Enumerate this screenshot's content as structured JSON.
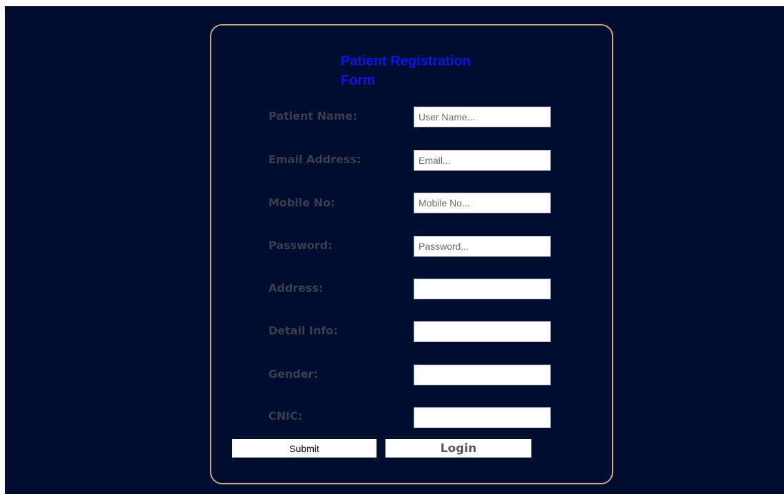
{
  "form": {
    "title": "Patient Registration Form",
    "fields": [
      {
        "label": "Patient Name:",
        "placeholder": "User Name...",
        "value": ""
      },
      {
        "label": "Email Address:",
        "placeholder": "Email...",
        "value": ""
      },
      {
        "label": "Mobile No:",
        "placeholder": "Mobile No...",
        "value": ""
      },
      {
        "label": "Password:",
        "placeholder": "Password...",
        "value": ""
      },
      {
        "label": "Address:",
        "placeholder": "",
        "value": ""
      },
      {
        "label": "Detail Info:",
        "placeholder": "",
        "value": ""
      },
      {
        "label": "Gender:",
        "placeholder": "",
        "value": ""
      },
      {
        "label": "CNIC:",
        "placeholder": "",
        "value": ""
      }
    ],
    "submit_label": "Submit",
    "login_label": "Login"
  },
  "colors": {
    "background": "#000c30",
    "card_border": "#c9a882",
    "title": "#0a14f0",
    "label": "#3a3e4d"
  }
}
